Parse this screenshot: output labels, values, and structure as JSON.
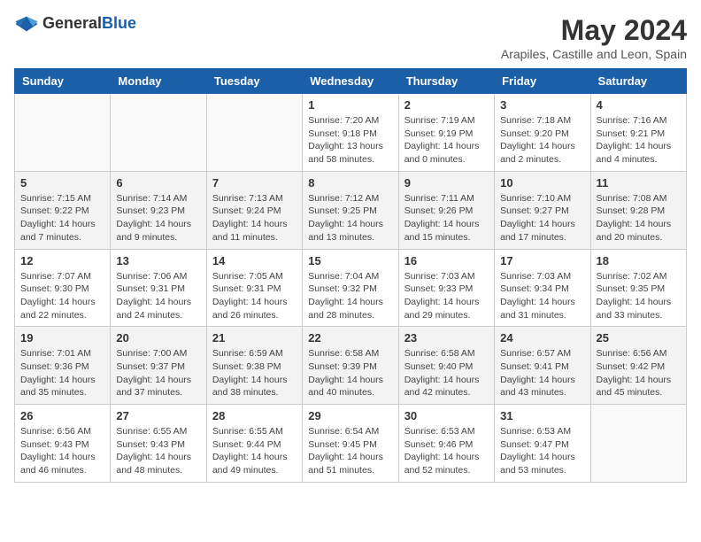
{
  "logo": {
    "text_general": "General",
    "text_blue": "Blue"
  },
  "title": "May 2024",
  "subtitle": "Arapiles, Castille and Leon, Spain",
  "days_of_week": [
    "Sunday",
    "Monday",
    "Tuesday",
    "Wednesday",
    "Thursday",
    "Friday",
    "Saturday"
  ],
  "weeks": [
    [
      {
        "day": "",
        "info": ""
      },
      {
        "day": "",
        "info": ""
      },
      {
        "day": "",
        "info": ""
      },
      {
        "day": "1",
        "info": "Sunrise: 7:20 AM\nSunset: 9:18 PM\nDaylight: 13 hours\nand 58 minutes."
      },
      {
        "day": "2",
        "info": "Sunrise: 7:19 AM\nSunset: 9:19 PM\nDaylight: 14 hours\nand 0 minutes."
      },
      {
        "day": "3",
        "info": "Sunrise: 7:18 AM\nSunset: 9:20 PM\nDaylight: 14 hours\nand 2 minutes."
      },
      {
        "day": "4",
        "info": "Sunrise: 7:16 AM\nSunset: 9:21 PM\nDaylight: 14 hours\nand 4 minutes."
      }
    ],
    [
      {
        "day": "5",
        "info": "Sunrise: 7:15 AM\nSunset: 9:22 PM\nDaylight: 14 hours\nand 7 minutes."
      },
      {
        "day": "6",
        "info": "Sunrise: 7:14 AM\nSunset: 9:23 PM\nDaylight: 14 hours\nand 9 minutes."
      },
      {
        "day": "7",
        "info": "Sunrise: 7:13 AM\nSunset: 9:24 PM\nDaylight: 14 hours\nand 11 minutes."
      },
      {
        "day": "8",
        "info": "Sunrise: 7:12 AM\nSunset: 9:25 PM\nDaylight: 14 hours\nand 13 minutes."
      },
      {
        "day": "9",
        "info": "Sunrise: 7:11 AM\nSunset: 9:26 PM\nDaylight: 14 hours\nand 15 minutes."
      },
      {
        "day": "10",
        "info": "Sunrise: 7:10 AM\nSunset: 9:27 PM\nDaylight: 14 hours\nand 17 minutes."
      },
      {
        "day": "11",
        "info": "Sunrise: 7:08 AM\nSunset: 9:28 PM\nDaylight: 14 hours\nand 20 minutes."
      }
    ],
    [
      {
        "day": "12",
        "info": "Sunrise: 7:07 AM\nSunset: 9:30 PM\nDaylight: 14 hours\nand 22 minutes."
      },
      {
        "day": "13",
        "info": "Sunrise: 7:06 AM\nSunset: 9:31 PM\nDaylight: 14 hours\nand 24 minutes."
      },
      {
        "day": "14",
        "info": "Sunrise: 7:05 AM\nSunset: 9:31 PM\nDaylight: 14 hours\nand 26 minutes."
      },
      {
        "day": "15",
        "info": "Sunrise: 7:04 AM\nSunset: 9:32 PM\nDaylight: 14 hours\nand 28 minutes."
      },
      {
        "day": "16",
        "info": "Sunrise: 7:03 AM\nSunset: 9:33 PM\nDaylight: 14 hours\nand 29 minutes."
      },
      {
        "day": "17",
        "info": "Sunrise: 7:03 AM\nSunset: 9:34 PM\nDaylight: 14 hours\nand 31 minutes."
      },
      {
        "day": "18",
        "info": "Sunrise: 7:02 AM\nSunset: 9:35 PM\nDaylight: 14 hours\nand 33 minutes."
      }
    ],
    [
      {
        "day": "19",
        "info": "Sunrise: 7:01 AM\nSunset: 9:36 PM\nDaylight: 14 hours\nand 35 minutes."
      },
      {
        "day": "20",
        "info": "Sunrise: 7:00 AM\nSunset: 9:37 PM\nDaylight: 14 hours\nand 37 minutes."
      },
      {
        "day": "21",
        "info": "Sunrise: 6:59 AM\nSunset: 9:38 PM\nDaylight: 14 hours\nand 38 minutes."
      },
      {
        "day": "22",
        "info": "Sunrise: 6:58 AM\nSunset: 9:39 PM\nDaylight: 14 hours\nand 40 minutes."
      },
      {
        "day": "23",
        "info": "Sunrise: 6:58 AM\nSunset: 9:40 PM\nDaylight: 14 hours\nand 42 minutes."
      },
      {
        "day": "24",
        "info": "Sunrise: 6:57 AM\nSunset: 9:41 PM\nDaylight: 14 hours\nand 43 minutes."
      },
      {
        "day": "25",
        "info": "Sunrise: 6:56 AM\nSunset: 9:42 PM\nDaylight: 14 hours\nand 45 minutes."
      }
    ],
    [
      {
        "day": "26",
        "info": "Sunrise: 6:56 AM\nSunset: 9:43 PM\nDaylight: 14 hours\nand 46 minutes."
      },
      {
        "day": "27",
        "info": "Sunrise: 6:55 AM\nSunset: 9:43 PM\nDaylight: 14 hours\nand 48 minutes."
      },
      {
        "day": "28",
        "info": "Sunrise: 6:55 AM\nSunset: 9:44 PM\nDaylight: 14 hours\nand 49 minutes."
      },
      {
        "day": "29",
        "info": "Sunrise: 6:54 AM\nSunset: 9:45 PM\nDaylight: 14 hours\nand 51 minutes."
      },
      {
        "day": "30",
        "info": "Sunrise: 6:53 AM\nSunset: 9:46 PM\nDaylight: 14 hours\nand 52 minutes."
      },
      {
        "day": "31",
        "info": "Sunrise: 6:53 AM\nSunset: 9:47 PM\nDaylight: 14 hours\nand 53 minutes."
      },
      {
        "day": "",
        "info": ""
      }
    ]
  ]
}
